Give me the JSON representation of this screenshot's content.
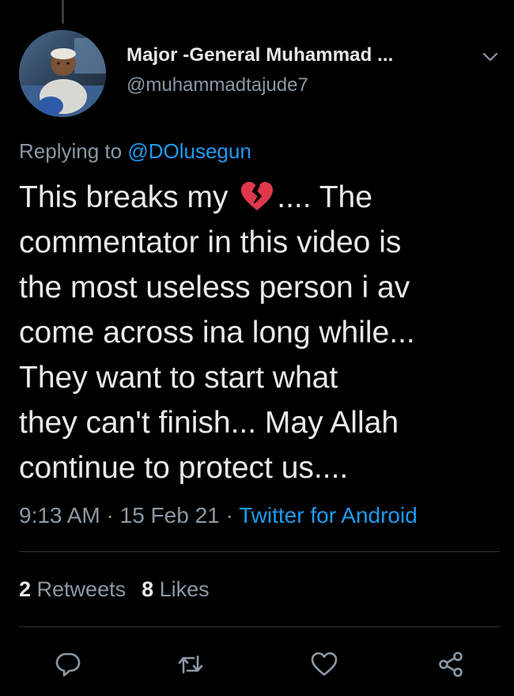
{
  "tweet": {
    "author": {
      "display_name": "Major -General Muhammad ...",
      "handle": "@muhammadtajude7"
    },
    "replying": {
      "prefix": "Replying to ",
      "mention": "@DOlusegun"
    },
    "body": {
      "line1_before_emoji": "This breaks my ",
      "emoji": "broken-heart",
      "line1_after_emoji": ".... The",
      "line2": "commentator in this video is",
      "line3": "the most useless person i av",
      "line4": "come across ina long while...",
      "line5": "They want to start what",
      "line6": "they can't finish... May Allah",
      "line7": "continue to protect us...."
    },
    "meta": {
      "time": "9:13 AM",
      "separator1": " · ",
      "date": "15 Feb 21",
      "separator2": " · ",
      "source": "Twitter for Android"
    },
    "stats": {
      "retweets_count": "2",
      "retweets_label": " Retweets",
      "likes_count": "8",
      "likes_label": " Likes"
    }
  },
  "actions": [
    "reply-icon",
    "retweet-icon",
    "like-icon",
    "share-icon"
  ],
  "colors": {
    "background": "#000000",
    "text": "#e7e9ea",
    "secondary": "#8b98a5",
    "accent": "#1d9bf0",
    "divider": "#2f3336"
  }
}
